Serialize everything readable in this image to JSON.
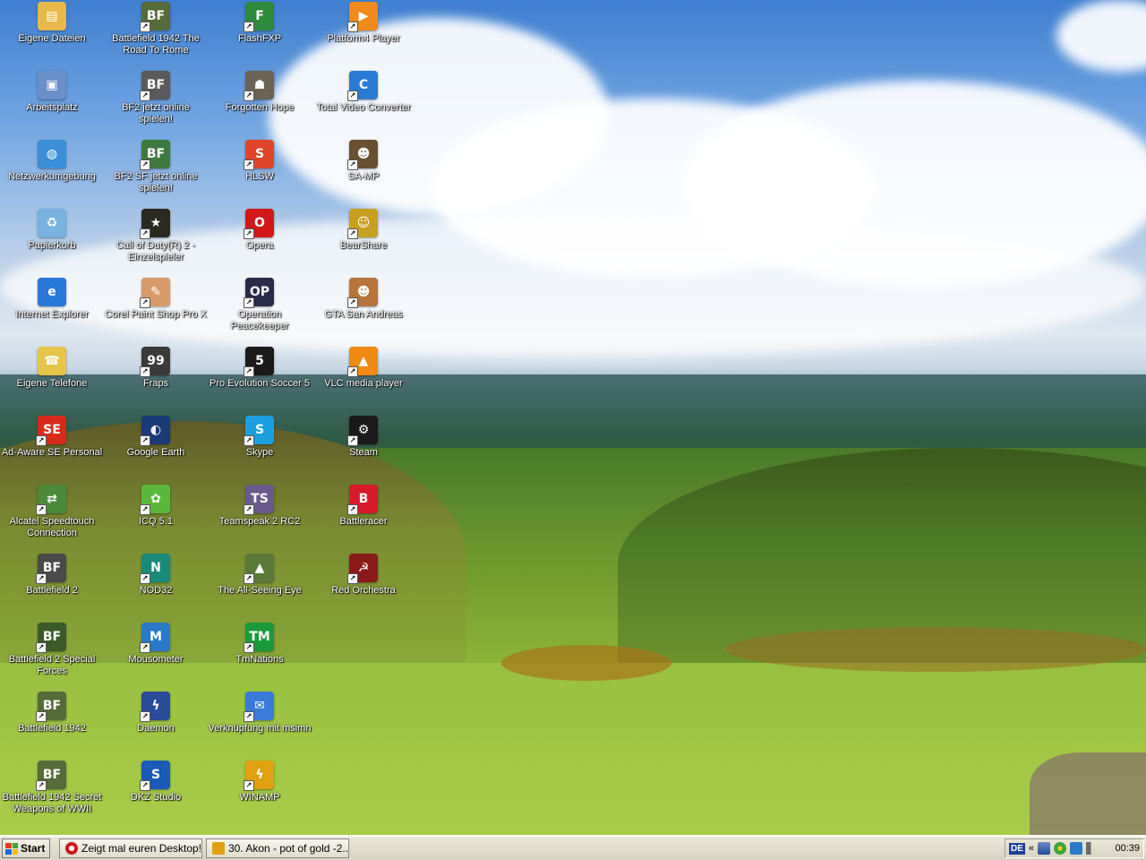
{
  "colors": {
    "taskbar": "#ece9d8",
    "label_text": "#ffffff"
  },
  "desktop": {
    "icons": [
      {
        "label": "Eigene Dateien",
        "icon": "folder-documents-icon",
        "color": "#e7b94a",
        "glyph": "▤",
        "shortcut": false
      },
      {
        "label": "Battlefield 1942 The Road To Rome",
        "icon": "battlefield-1942-icon",
        "color": "#556b3a",
        "glyph": "BF",
        "shortcut": true
      },
      {
        "label": "FlashFXP",
        "icon": "flashfxp-icon",
        "color": "#2e8b3e",
        "glyph": "F",
        "shortcut": true
      },
      {
        "label": "Platform4 Player",
        "icon": "platform4-player-icon",
        "color": "#f08a1c",
        "glyph": "▶",
        "shortcut": true
      },
      {
        "label": "Arbeitsplatz",
        "icon": "my-computer-icon",
        "color": "#6a8fc9",
        "glyph": "▣",
        "shortcut": false
      },
      {
        "label": "BF2 jetzt online spielen!",
        "icon": "bf2-online-icon",
        "color": "#5a5a5a",
        "glyph": "BF",
        "shortcut": true
      },
      {
        "label": "Forgotten Hope",
        "icon": "forgotten-hope-icon",
        "color": "#6b6452",
        "glyph": "☗",
        "shortcut": true
      },
      {
        "label": "Total Video Converter",
        "icon": "total-video-converter-icon",
        "color": "#2a7bd4",
        "glyph": "C",
        "shortcut": true
      },
      {
        "label": "Netzwerkumgebung",
        "icon": "network-places-icon",
        "color": "#3a8fd8",
        "glyph": "◍",
        "shortcut": false
      },
      {
        "label": "BF2 SF jetzt online spielen!",
        "icon": "bf2sf-online-icon",
        "color": "#3e7a3e",
        "glyph": "BF",
        "shortcut": true
      },
      {
        "label": "HLSW",
        "icon": "hlsw-icon",
        "color": "#e0452a",
        "glyph": "S",
        "shortcut": true
      },
      {
        "label": "SA-MP",
        "icon": "samp-icon",
        "color": "#6a5030",
        "glyph": "☻",
        "shortcut": true
      },
      {
        "label": "Papierkorb",
        "icon": "recycle-bin-icon",
        "color": "#7ab3e0",
        "glyph": "♻",
        "shortcut": false
      },
      {
        "label": "Call of Duty(R) 2 - Einzelspieler",
        "icon": "call-of-duty-2-icon",
        "color": "#2a2a20",
        "glyph": "★",
        "shortcut": true
      },
      {
        "label": "Opera",
        "icon": "opera-icon",
        "color": "#d01818",
        "glyph": "O",
        "shortcut": true
      },
      {
        "label": "BearShare",
        "icon": "bearshare-icon",
        "color": "#c8a020",
        "glyph": "☺",
        "shortcut": true
      },
      {
        "label": "Internet Explorer",
        "icon": "internet-explorer-icon",
        "color": "#2a78d8",
        "glyph": "e",
        "shortcut": false
      },
      {
        "label": "Corel Paint Shop Pro X",
        "icon": "paint-shop-pro-icon",
        "color": "#d89a6a",
        "glyph": "✎",
        "shortcut": true
      },
      {
        "label": "Operation Peacekeeper",
        "icon": "operation-peacekeeper-icon",
        "color": "#2a2a4a",
        "glyph": "OP",
        "shortcut": true
      },
      {
        "label": "GTA San Andreas",
        "icon": "gta-san-andreas-icon",
        "color": "#b8743a",
        "glyph": "☻",
        "shortcut": true
      },
      {
        "label": "Eigene Telefone",
        "icon": "phones-folder-icon",
        "color": "#e7c44a",
        "glyph": "☎",
        "shortcut": false
      },
      {
        "label": "Fraps",
        "icon": "fraps-icon",
        "color": "#3a3a3a",
        "glyph": "99",
        "shortcut": true
      },
      {
        "label": "Pro Evolution Soccer 5",
        "icon": "pes5-icon",
        "color": "#1a1a1a",
        "glyph": "5",
        "shortcut": true
      },
      {
        "label": "VLC media player",
        "icon": "vlc-icon",
        "color": "#f08a10",
        "glyph": "▲",
        "shortcut": true
      },
      {
        "label": "Ad-Aware SE Personal",
        "icon": "ad-aware-icon",
        "color": "#d82a1a",
        "glyph": "SE",
        "shortcut": true
      },
      {
        "label": "Google Earth",
        "icon": "google-earth-icon",
        "color": "#1a3a78",
        "glyph": "◐",
        "shortcut": true
      },
      {
        "label": "Skype",
        "icon": "skype-icon",
        "color": "#1aa0e0",
        "glyph": "S",
        "shortcut": true
      },
      {
        "label": "Steam",
        "icon": "steam-icon",
        "color": "#1a1a1a",
        "glyph": "⚙",
        "shortcut": true
      },
      {
        "label": "Alcatel Speedtouch Connection",
        "icon": "speedtouch-icon",
        "color": "#4a8a3a",
        "glyph": "⇄",
        "shortcut": true
      },
      {
        "label": "ICQ 5.1",
        "icon": "icq-icon",
        "color": "#5ab83a",
        "glyph": "✿",
        "shortcut": true
      },
      {
        "label": "Teamspeak 2 RC2",
        "icon": "teamspeak-icon",
        "color": "#6a5a8a",
        "glyph": "TS",
        "shortcut": true
      },
      {
        "label": "Battleracer",
        "icon": "battleracer-icon",
        "color": "#d81a2a",
        "glyph": "B",
        "shortcut": true
      },
      {
        "label": "Battlefield 2",
        "icon": "battlefield-2-icon",
        "color": "#4a4a4a",
        "glyph": "BF",
        "shortcut": true
      },
      {
        "label": "NOD32",
        "icon": "nod32-icon",
        "color": "#1a8a7a",
        "glyph": "N",
        "shortcut": true
      },
      {
        "label": "The All-Seeing Eye",
        "icon": "all-seeing-eye-icon",
        "color": "#5a7a3a",
        "glyph": "▲",
        "shortcut": true
      },
      {
        "label": "Red Orchestra",
        "icon": "red-orchestra-icon",
        "color": "#8a1a1a",
        "glyph": "☭",
        "shortcut": true
      },
      {
        "label": "Battlefield 2 Special Forces",
        "icon": "bf2-special-forces-icon",
        "color": "#3a5a2a",
        "glyph": "BF",
        "shortcut": true
      },
      {
        "label": "Mousometer",
        "icon": "mousometer-icon",
        "color": "#2a7ac8",
        "glyph": "M",
        "shortcut": true
      },
      {
        "label": "TmNations",
        "icon": "tmnations-icon",
        "color": "#1a9a3a",
        "glyph": "TM",
        "shortcut": true
      },
      {
        "label": "Battlefield 1942",
        "icon": "battlefield-1942-icon",
        "color": "#556b3a",
        "glyph": "BF",
        "shortcut": true
      },
      {
        "label": "Daemon",
        "icon": "daemon-tools-icon",
        "color": "#2a4a9a",
        "glyph": "ϟ",
        "shortcut": true
      },
      {
        "label": "Verknüpfung mit msimn",
        "icon": "outlook-express-icon",
        "color": "#3a7ad8",
        "glyph": "✉",
        "shortcut": true
      },
      {
        "label": "Battlefield 1942 Secret Weapons of WWII",
        "icon": "bf1942-secret-weapons-icon",
        "color": "#556b3a",
        "glyph": "BF",
        "shortcut": true
      },
      {
        "label": "DKZ Studio",
        "icon": "dkz-studio-icon",
        "color": "#1a5ab8",
        "glyph": "S",
        "shortcut": true
      },
      {
        "label": "WINAMP",
        "icon": "winamp-icon",
        "color": "#e0a010",
        "glyph": "ϟ",
        "shortcut": true
      }
    ]
  },
  "taskbar": {
    "start_label": "Start",
    "tasks": [
      {
        "label": "Zeigt mal euren Desktop!...",
        "icon": "opera-icon",
        "color": "#d01818"
      },
      {
        "label": "30. Akon - pot of gold -2...",
        "icon": "winamp-icon",
        "color": "#e0a010"
      }
    ],
    "tray": {
      "language": "DE",
      "icons": [
        "show-hidden-icons",
        "network-icon",
        "icq-tray-icon",
        "mouse-tray-icon",
        "speaker-icon"
      ],
      "clock": "00:39"
    }
  }
}
